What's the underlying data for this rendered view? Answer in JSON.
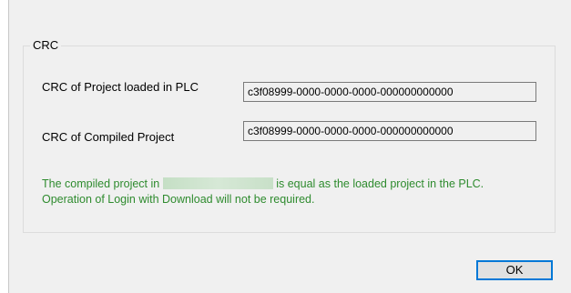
{
  "group": {
    "title": "CRC"
  },
  "rows": [
    {
      "label": "CRC of Project loaded in PLC",
      "value": "c3f08999-0000-0000-0000-000000000000"
    },
    {
      "label": "CRC of Compiled Project",
      "value": "c3f08999-0000-0000-0000-000000000000"
    }
  ],
  "message": {
    "line1_before": "The compiled project in",
    "line1_after": "is equal as the loaded project in the PLC.",
    "line2": "Operation of Login with Download will not be required.",
    "color": "#2e8b2e"
  },
  "buttons": {
    "ok_label": "OK"
  }
}
